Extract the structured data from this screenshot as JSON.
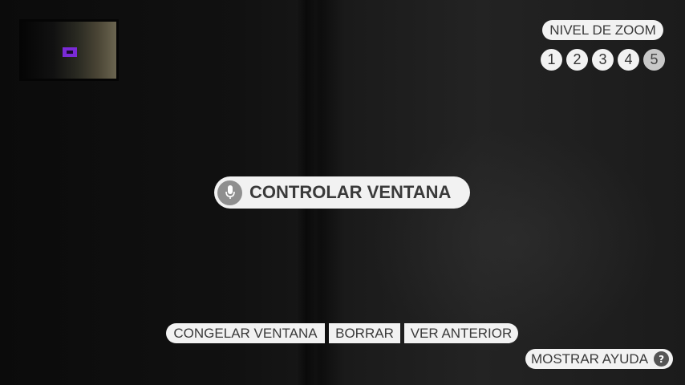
{
  "zoom": {
    "label": "NIVEL DE ZOOM",
    "levels": [
      "1",
      "2",
      "3",
      "4",
      "5"
    ],
    "selected": "5"
  },
  "main_command": {
    "label": "CONTROLAR VENTANA",
    "icon": "microphone-icon"
  },
  "commands": {
    "freeze": "CONGELAR VENTANA",
    "clear": "BORRAR",
    "previous": "VER ANTERIOR"
  },
  "help": {
    "label": "MOSTRAR AYUDA",
    "icon_glyph": "?"
  },
  "colors": {
    "pill_bg": "#f2f2f2",
    "pill_text": "#3a3a3a",
    "minimap_highlight": "#7a2ad6",
    "mic_bg": "#8f8f8f"
  }
}
